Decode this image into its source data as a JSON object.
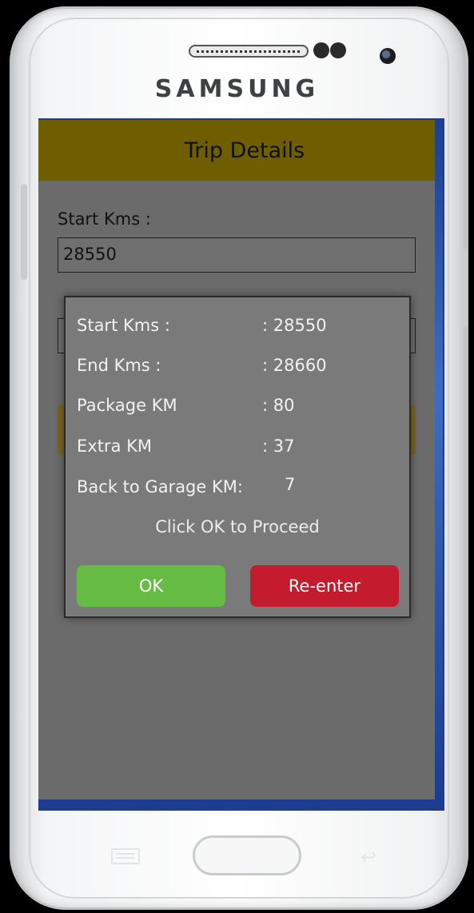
{
  "device": {
    "brand": "SAMSUNG"
  },
  "appbar": {
    "title": "Trip Details"
  },
  "form": {
    "start_label": "Start Kms :",
    "start_value": "28550"
  },
  "dialog": {
    "rows": [
      {
        "label": "Start Kms :",
        "value": ": 28550"
      },
      {
        "label": "End Kms :",
        "value": ": 28660"
      },
      {
        "label": "Package KM",
        "value": ": 80"
      },
      {
        "label": "Extra KM",
        "value": ": 37"
      },
      {
        "label": "Back to Garage KM:",
        "value": "7"
      }
    ],
    "prompt": "Click OK to Proceed",
    "ok_label": "OK",
    "reenter_label": "Re-enter"
  },
  "colors": {
    "appbar": "#6e5e00",
    "ok_button": "#66bb44",
    "reenter_button": "#c41c2e",
    "screen_background": "#6b6b6b"
  }
}
